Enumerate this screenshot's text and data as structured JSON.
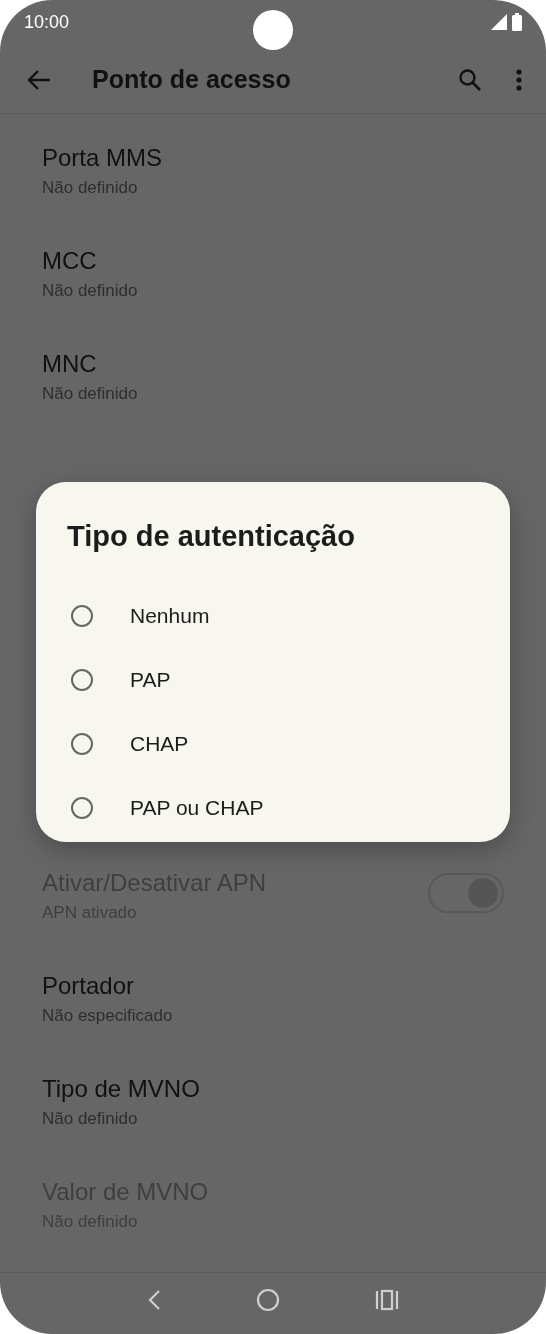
{
  "status_bar": {
    "time": "10:00"
  },
  "toolbar": {
    "title": "Ponto de acesso"
  },
  "list_top": [
    {
      "kind": "text",
      "title": "Porta MMS",
      "subtitle": "Não definido",
      "disabled": false
    },
    {
      "kind": "text",
      "title": "MCC",
      "subtitle": "Não definido",
      "disabled": false
    },
    {
      "kind": "text",
      "title": "MNC",
      "subtitle": "Não definido",
      "disabled": false
    }
  ],
  "list_bottom": [
    {
      "kind": "toggle",
      "title": "Ativar/Desativar APN",
      "subtitle": "APN ativado",
      "disabled": true,
      "on": true
    },
    {
      "kind": "text",
      "title": "Portador",
      "subtitle": "Não especificado",
      "disabled": false
    },
    {
      "kind": "text",
      "title": "Tipo de MVNO",
      "subtitle": "Não definido",
      "disabled": false
    },
    {
      "kind": "text",
      "title": "Valor de MVNO",
      "subtitle": "Não definido",
      "disabled": true
    }
  ],
  "dialog": {
    "title": "Tipo de autenticação",
    "options": [
      {
        "label": "Nenhum",
        "selected": false
      },
      {
        "label": "PAP",
        "selected": false
      },
      {
        "label": "CHAP",
        "selected": false
      },
      {
        "label": "PAP ou CHAP",
        "selected": false
      }
    ]
  }
}
